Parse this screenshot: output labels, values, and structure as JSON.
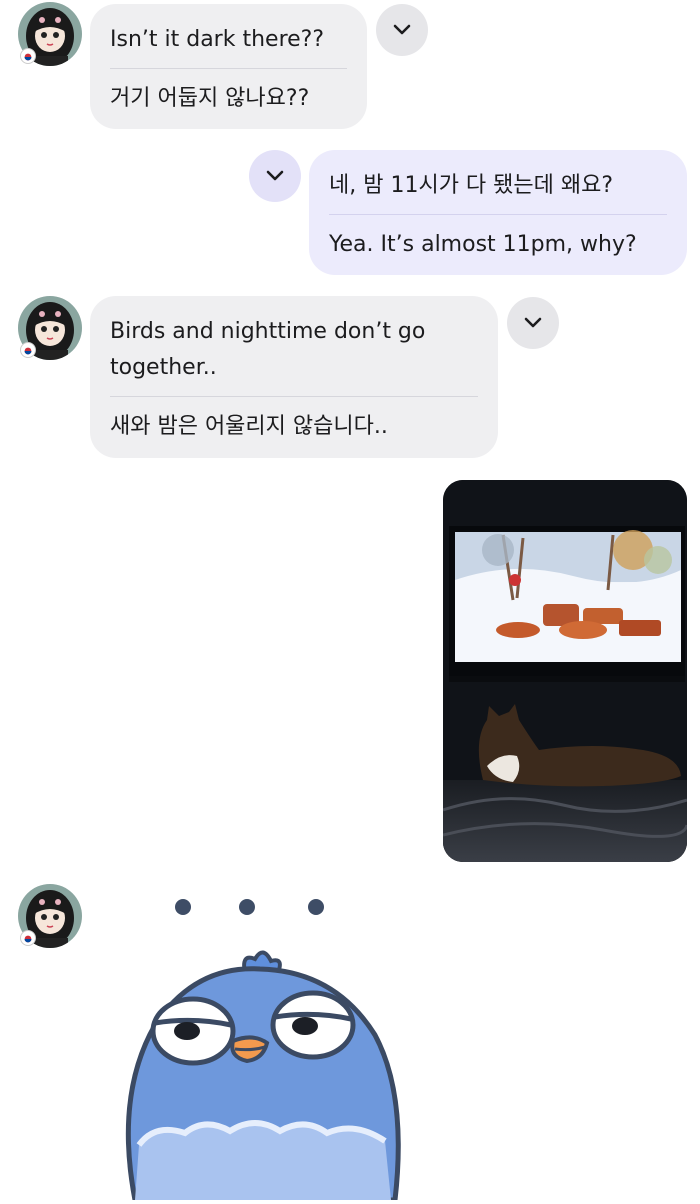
{
  "messages": [
    {
      "direction": "incoming",
      "original": "Isn’t it dark there??",
      "translation": "거기 어둡지 않나요??"
    },
    {
      "direction": "outgoing",
      "original": "네, 밤 11시가 다 됐는데 왜요?",
      "translation": "Yea. It’s almost 11pm, why?"
    },
    {
      "direction": "incoming",
      "original": "Birds and nighttime  don’t go together..",
      "translation": "새와 밤은 어울리지 않습니다.."
    }
  ],
  "icons": {
    "avatar": "girl-avatar-icon",
    "flag": "korea-flag-icon",
    "expand": "chevron-down-icon",
    "sticker": "blue-bird-sticker",
    "photo": "cat-watching-tv-photo"
  },
  "colors": {
    "incoming_bubble": "#efeff1",
    "outgoing_bubble": "#ecebfc",
    "bird_blue": "#6e98dc"
  }
}
